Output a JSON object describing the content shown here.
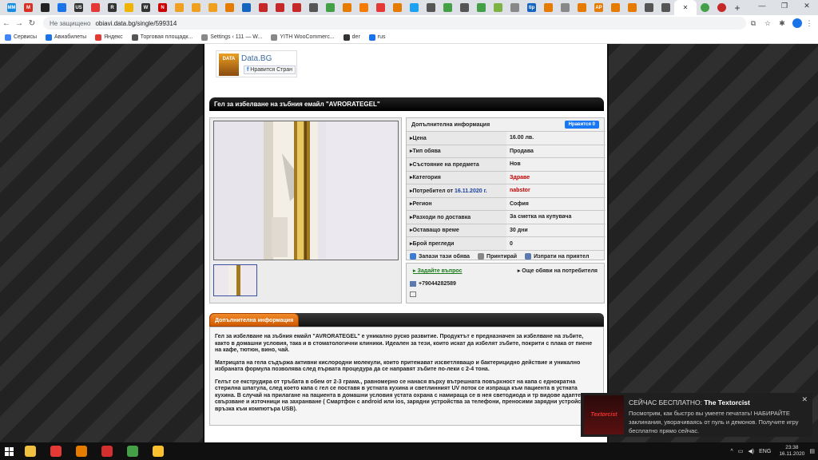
{
  "browser": {
    "tabs": [
      {
        "icon": "mail-ru-icon",
        "color": "#168de2",
        "label": "ММ"
      },
      {
        "icon": "gmail-icon",
        "color": "#d93025",
        "label": "M"
      },
      {
        "icon": "yandex-zen-icon",
        "color": "#222",
        "label": ""
      },
      {
        "icon": "opera-icon",
        "color": "#1a73e8",
        "label": ""
      },
      {
        "icon": "us-icon",
        "color": "#333",
        "label": "US"
      },
      {
        "icon": "yandex-icon",
        "color": "#e53935",
        "label": ""
      },
      {
        "icon": "ru-icon",
        "color": "#333",
        "label": "R"
      },
      {
        "icon": "smile-icon",
        "color": "#f0b400",
        "label": ""
      },
      {
        "icon": "w-icon",
        "color": "#333",
        "label": "W"
      },
      {
        "icon": "n-icon",
        "color": "#c00",
        "label": "N"
      },
      {
        "icon": "circle-icon",
        "color": "#f0a020",
        "label": ""
      },
      {
        "icon": "circle-icon",
        "color": "#f0a020",
        "label": ""
      },
      {
        "icon": "circle-icon",
        "color": "#f0a020",
        "label": ""
      },
      {
        "icon": "arrow-icon",
        "color": "#e57c00",
        "label": ""
      },
      {
        "icon": "page-icon",
        "color": "#1565c0",
        "label": ""
      },
      {
        "icon": "r-icon",
        "color": "#c62828",
        "label": ""
      },
      {
        "icon": "r-icon",
        "color": "#c62828",
        "label": ""
      },
      {
        "icon": "r-icon",
        "color": "#c62828",
        "label": ""
      },
      {
        "icon": "globe-icon",
        "color": "#555",
        "label": ""
      },
      {
        "icon": "green-icon",
        "color": "#43a047",
        "label": ""
      },
      {
        "icon": "arrow-icon",
        "color": "#e57c00",
        "label": ""
      },
      {
        "icon": "home-icon",
        "color": "#f57c00",
        "label": ""
      },
      {
        "icon": "opera-icon",
        "color": "#e53935",
        "label": ""
      },
      {
        "icon": "arrow-icon",
        "color": "#e57c00",
        "label": ""
      },
      {
        "icon": "tw-icon",
        "color": "#1da1f2",
        "label": ""
      },
      {
        "icon": "gear-icon",
        "color": "#555",
        "label": ""
      },
      {
        "icon": "sync-icon",
        "color": "#43a047",
        "label": ""
      },
      {
        "icon": "globe-icon",
        "color": "#555",
        "label": ""
      },
      {
        "icon": "green-icon",
        "color": "#43a047",
        "label": ""
      },
      {
        "icon": "leaf-icon",
        "color": "#7cb342",
        "label": ""
      },
      {
        "icon": "page-icon",
        "color": "#888",
        "label": ""
      },
      {
        "icon": "tip-icon",
        "color": "#1565c0",
        "label": "tip"
      },
      {
        "icon": "orange-icon",
        "color": "#e57c00",
        "label": ""
      },
      {
        "icon": "page-icon",
        "color": "#888",
        "label": ""
      },
      {
        "icon": "orange-icon",
        "color": "#e57c00",
        "label": ""
      },
      {
        "icon": "orange-icon",
        "color": "#e57c00",
        "label": "AP"
      },
      {
        "icon": "orange-icon",
        "color": "#e57c00",
        "label": ""
      },
      {
        "icon": "orange-icon",
        "color": "#e57c00",
        "label": ""
      },
      {
        "icon": "globe-icon",
        "color": "#555",
        "label": ""
      },
      {
        "icon": "globe-icon",
        "color": "#555",
        "label": ""
      }
    ],
    "active_tab_close": "✕",
    "other_tabs": [
      {
        "color": "#43a047"
      },
      {
        "color": "#c62828"
      }
    ],
    "new_tab": "+",
    "window_controls": [
      "—",
      "❐",
      "✕"
    ],
    "security": "Не защищено",
    "url": "obiavi.data.bg/single/599314",
    "bookmarks": [
      {
        "label": "Сервисы",
        "color": "#4285f4"
      },
      {
        "label": "Авиабилеты",
        "color": "#1a73e8"
      },
      {
        "label": "Яндекс",
        "color": "#e53935"
      },
      {
        "label": "Торговая площадк...",
        "color": "#555"
      },
      {
        "label": "Settings ‹ 111 — W...",
        "color": "#888"
      },
      {
        "label": "YITH WooCommerc...",
        "color": "#888"
      },
      {
        "label": "der",
        "color": "#333"
      },
      {
        "label": "rus",
        "color": "#1a73e8"
      }
    ]
  },
  "site": {
    "logo_text": "DATA",
    "name": "Data.BG",
    "like_label": "Нравится Стран",
    "ad_title": "Гел за избелване на зъбния емайл \"AVRORATEGEL\"",
    "info_header": "Допълнителна информация",
    "fb_like": "Нравится 0",
    "details": [
      {
        "key": "Цена",
        "value": "16.00 лв."
      },
      {
        "key": "Тип обява",
        "value": "Продава"
      },
      {
        "key": "Състояние на предмета",
        "value": "Нов"
      },
      {
        "key": "Категория",
        "value": "Здраве"
      },
      {
        "key": "Потребител от",
        "key_date": "16.11.2020 г.",
        "value": "nabstor"
      },
      {
        "key": "Регион",
        "value": "София"
      },
      {
        "key": "Разходи по доставка",
        "value": "За сметка на купувача"
      },
      {
        "key": "Оставащо време",
        "value": "30 дни"
      },
      {
        "key": "Брой прегледи",
        "value": "0"
      }
    ],
    "actions": [
      "Запази тази обява",
      "Принтирай",
      "Изпрати на приятел"
    ],
    "ask_question": "Задайте въпрос",
    "more_ads": "Още обяви на потребителя",
    "phone": "+79044282589",
    "desc_tab": "Допълнителна информация",
    "desc_paragraphs": [
      "Гел за избелване на зъбния емайл \"AVRORATEGEL\" е уникално руско развитие. Продуктът е предназначен за избелване на зъбите, както в домашни условия, така и в стоматологични клиники. Идеален за тези, които искат да избелят зъбите, покрити с плака от пиене на кафе, тютюн, вино, чай.",
      "Матрицата на гела съдържа активни кислородни молекули, които притежават изсветляващо и бактерицидно действие и уникално избраната формула позволява след първата процедура да се направят зъбите по-леки с 2-4 тона.",
      "Гелът се екструдира от тръбата в обем от 2-3 грама., равномерно се нанася върху вътрешната повърхност на капа с еднократна стерилна шпатула, след което капа с гел се поставя в устната кухина и светлинният UV поток се изпраща към пациента в устната кухина. В случай на прилагане на пациента в домашни условия устата охрана с намираща се в нея светодиода и тр видове адаптери за свързване и източници на захранване ( Смартфон с android или ios, зарядни устройства за телефони, преносими зарядни устройства и връзка към компютъра USB)."
    ]
  },
  "toast": {
    "title_prefix": "СЕЙЧАС БЕСПЛАТНО:",
    "title_game": "The Textorcist",
    "body": "Посмотрим, как быстро вы умеете печатать! НАБИРАЙТЕ заклинания, уворачиваясь от пуль и демонов. Получите игру бесплатно прямо сейчас.",
    "image_text": "Textorcist",
    "close": "✕"
  },
  "taskbar": {
    "apps": [
      {
        "name": "explorer",
        "color": "#f0c040"
      },
      {
        "name": "yandex-browser",
        "color": "#e53935"
      },
      {
        "name": "paint",
        "color": "#e57c00"
      },
      {
        "name": "opera",
        "color": "#d32f2f"
      },
      {
        "name": "utorrent",
        "color": "#43a047"
      },
      {
        "name": "chrome",
        "color": "#fbc02d"
      }
    ],
    "lang": "ENG",
    "time": "23:38",
    "date": "16.11.2020"
  }
}
